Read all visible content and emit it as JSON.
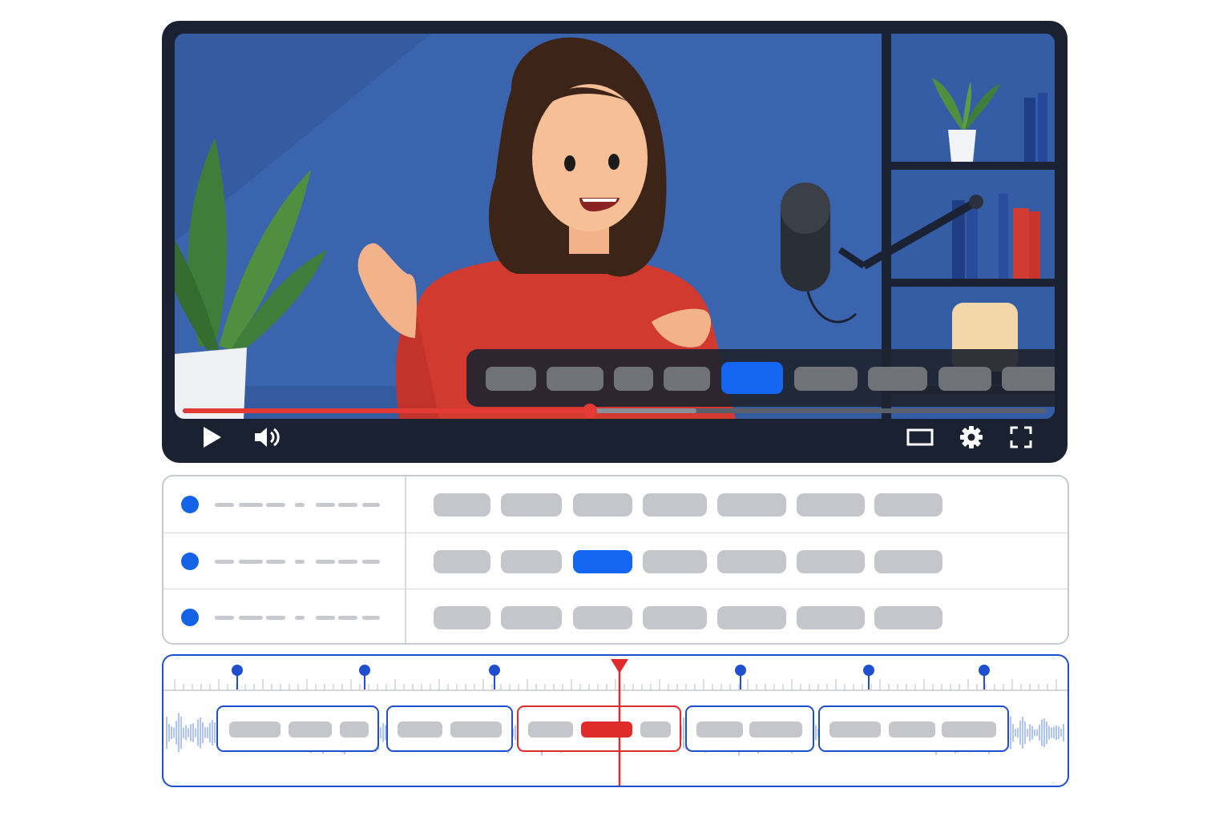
{
  "player": {
    "caption_segments": [
      {
        "active": false
      },
      {
        "active": false
      },
      {
        "active": false
      },
      {
        "active": false
      },
      {
        "active": true
      },
      {
        "active": false
      },
      {
        "active": false
      },
      {
        "active": false
      },
      {
        "active": false
      }
    ],
    "progress": {
      "played_fraction": 0.472,
      "buffered_fraction": 0.595
    },
    "controls": {
      "left": [
        "play-icon",
        "volume-icon"
      ],
      "right": [
        "theater-mode-icon",
        "settings-gear-icon",
        "fullscreen-icon"
      ]
    },
    "colors": {
      "accent": "#e33a36",
      "caption_highlight": "#1466f0",
      "frame": "#1a2130"
    }
  },
  "transcript_list": {
    "rows": [
      {
        "selected_segment_index": null
      },
      {
        "selected_segment_index": 2
      },
      {
        "selected_segment_index": null
      }
    ],
    "segments_per_row": 7,
    "colors": {
      "marker": "#1463e6",
      "highlight": "#1466f0"
    }
  },
  "timeline": {
    "marker_count": 6,
    "playhead_color": "#e02b2b",
    "segment_groups": [
      {
        "chip_count": 3,
        "active": false
      },
      {
        "chip_count": 2,
        "active": false
      },
      {
        "chip_count": 3,
        "active": true,
        "active_chip_index": 1
      },
      {
        "chip_count": 2,
        "active": false
      },
      {
        "chip_count": 3,
        "active": false
      }
    ],
    "colors": {
      "border": "#1f4fcf",
      "waveform": "#9bb6ee"
    }
  }
}
